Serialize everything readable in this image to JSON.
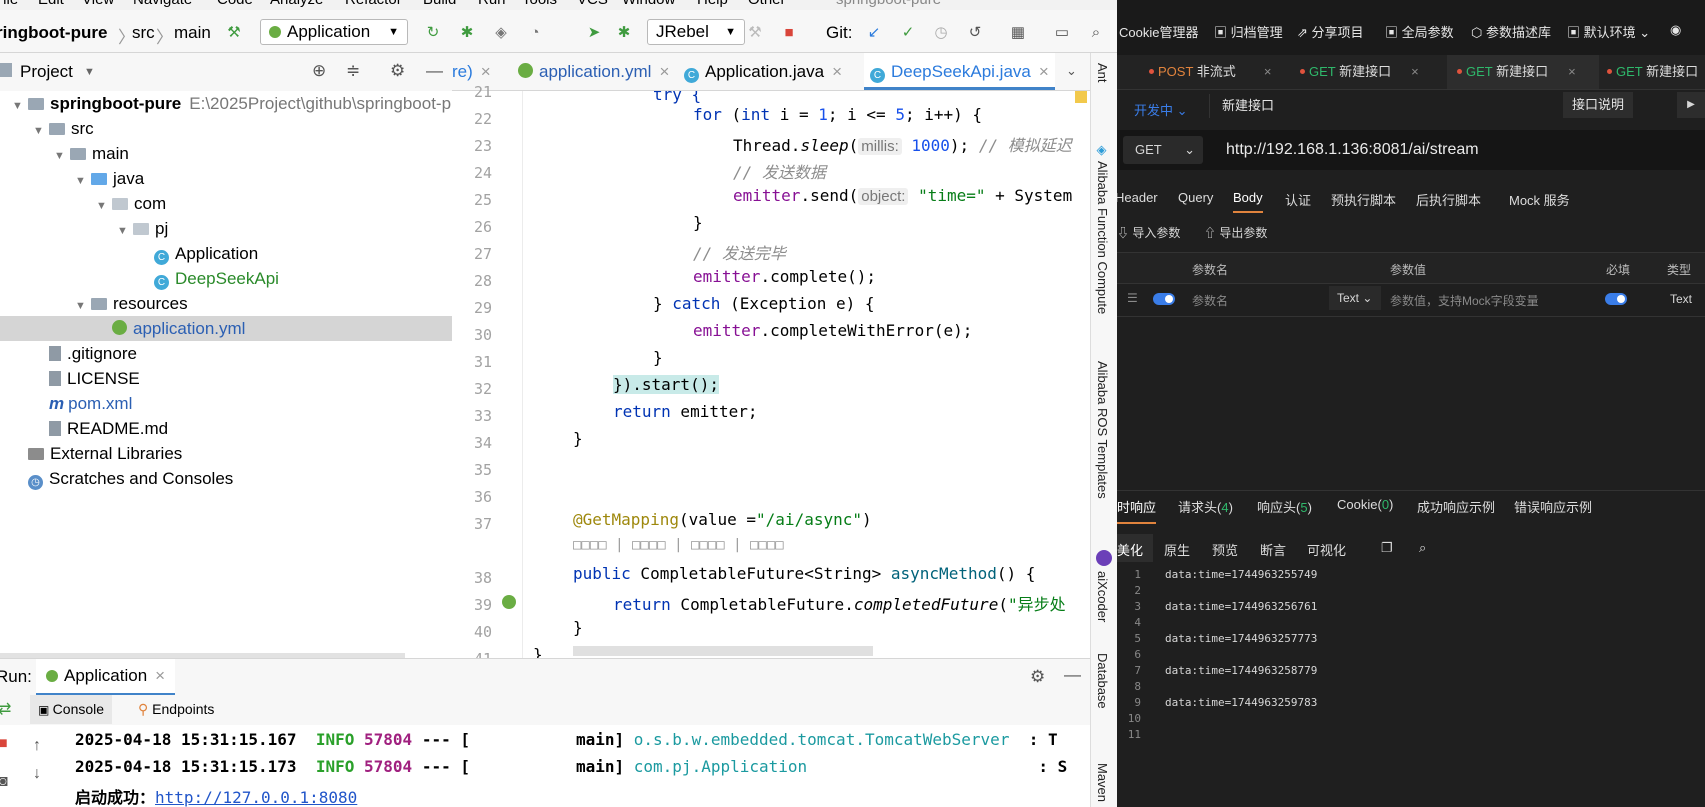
{
  "ide": {
    "menu": [
      "File",
      "Edit",
      "View",
      "Navigate",
      "Code",
      "Analyze",
      "Refactor",
      "Build",
      "Run",
      "Tools",
      "VCS",
      "Window",
      "Help",
      "Other"
    ],
    "window_title": "springboot-pure",
    "breadcrumb": {
      "project": "ringboot-pure",
      "sep": "〉",
      "src": "src",
      "main": "main"
    },
    "run_config": "Application",
    "jrebel": "JRebel",
    "git_label": "Git:",
    "project_panel": {
      "title": "Project"
    },
    "tree": [
      {
        "label": "springboot-pure",
        "path": "E:\\2025Project\\github\\springboot-p",
        "indent": 0,
        "icon": "folder",
        "bold": true
      },
      {
        "label": "src",
        "indent": 1,
        "icon": "folder"
      },
      {
        "label": "main",
        "indent": 2,
        "icon": "folder"
      },
      {
        "label": "java",
        "indent": 3,
        "icon": "folder-blue"
      },
      {
        "label": "com",
        "indent": 4,
        "icon": "package"
      },
      {
        "label": "pj",
        "indent": 5,
        "icon": "package"
      },
      {
        "label": "Application",
        "indent": 6,
        "icon": "class"
      },
      {
        "label": "DeepSeekApi",
        "indent": 6,
        "icon": "class",
        "color": "#2a8a2a"
      },
      {
        "label": "resources",
        "indent": 3,
        "icon": "folder"
      },
      {
        "label": "application.yml",
        "indent": 4,
        "icon": "yml",
        "selected": true,
        "color": "#2b5fb3"
      },
      {
        "label": ".gitignore",
        "indent": 1,
        "icon": "file"
      },
      {
        "label": "LICENSE",
        "indent": 1,
        "icon": "file"
      },
      {
        "label": "pom.xml",
        "indent": 1,
        "icon": "maven",
        "color": "#2b5fb3"
      },
      {
        "label": "README.md",
        "indent": 1,
        "icon": "file"
      },
      {
        "label": "External Libraries",
        "indent": 0,
        "icon": "library"
      },
      {
        "label": "Scratches and Consoles",
        "indent": 0,
        "icon": "scratch"
      }
    ],
    "editor_tabs": [
      {
        "label": "re)"
      },
      {
        "label": "application.yml"
      },
      {
        "label": "Application.java"
      },
      {
        "label": "DeepSeekApi.java",
        "active": true
      }
    ],
    "line_numbers": [
      "21",
      "22",
      "23",
      "24",
      "25",
      "26",
      "27",
      "28",
      "29",
      "30",
      "31",
      "32",
      "33",
      "34",
      "35",
      "36",
      "37",
      "",
      "38",
      "39",
      "40",
      "41"
    ],
    "code_lines": {
      "l21": "try {",
      "l22_kw": "for",
      "l22_a": " (",
      "l22_kw2": "int",
      "l22_b": " i = ",
      "l22_n1": "1",
      "l22_c": "; i <= ",
      "l22_n2": "5",
      "l22_d": "; i++) {",
      "l23_a": "Thread.",
      "l23_fn": "sleep",
      "l23_b": "(",
      "l23_hint": "millis:",
      "l23_n": " 1000",
      "l23_c": ");",
      "l23_cm": " // 模拟延迟",
      "l24_cm": "// 发送数据",
      "l25_a": "emitter",
      "l25_b": ".send(",
      "l25_hint": "object:",
      "l25_st": " \"time=\"",
      "l25_c": " + System",
      "l26": "}",
      "l27_cm": "// 发送完毕",
      "l28_a": "emitter",
      "l28_b": ".complete();",
      "l29_a": "} ",
      "l29_kw": "catch",
      "l29_b": " (Exception e) {",
      "l30_a": "emitter",
      "l30_b": ".completeWithError(e);",
      "l31": "}",
      "l32": "}).start();",
      "l33_kw": "return",
      "l33_b": " emitter;",
      "l34": "}",
      "l37_an": "@GetMapping",
      "l37_a": "(value =",
      "l37_st": "\"/ai/async\"",
      "l37_b": ")",
      "lens": "□□□□ | □□□□ | □□□□ | □□□□",
      "l38_kw": "public",
      "l38_a": " CompletableFuture<String> ",
      "l38_fn": "asyncMethod",
      "l38_b": "() {",
      "l39_kw": "return",
      "l39_a": " CompletableFuture.",
      "l39_fn": "completedFuture",
      "l39_b": "(",
      "l39_st": "\"异步处",
      "l40": "}",
      "l41": "}"
    },
    "right_strip": [
      "Ant",
      "Alibaba Function Compute",
      "Alibaba ROS Templates",
      "aiXcoder",
      "Database",
      "Maven"
    ],
    "run": {
      "label": "Run:",
      "config": "Application",
      "tabs": [
        "Console",
        "Endpoints"
      ]
    },
    "console": [
      {
        "ts": "2025-04-18 15:31:15.167",
        "level": "INFO",
        "pid": "57804",
        "sep": "--- [",
        "thread": "main]",
        "cls": "o.s.b.w.embedded.tomcat.TomcatWebServer",
        "tail": "  : T"
      },
      {
        "ts": "2025-04-18 15:31:15.173",
        "level": "INFO",
        "pid": "57804",
        "sep": "--- [",
        "thread": "main]",
        "cls": "com.pj.Application",
        "tail": "  : S"
      }
    ],
    "console_success": {
      "text": "启动成功：",
      "link": "http://127.0.0.1:8080"
    }
  },
  "api": {
    "top_items": [
      "Cookie管理器",
      "归档管理",
      "分享项目",
      "全局参数",
      "参数描述库",
      "默认环境"
    ],
    "tabs": [
      {
        "method": "POST",
        "label": "非流式"
      },
      {
        "method": "GET",
        "label": "新建接口"
      },
      {
        "method": "GET",
        "label": "新建接口",
        "active": true
      },
      {
        "method": "GET",
        "label": "新建接口"
      }
    ],
    "status": "开发中",
    "name": "新建接口",
    "doc_button": "接口说明",
    "method": "GET",
    "url": "http://192.168.1.136:8081/ai/stream",
    "request_tabs": [
      "Header",
      "Query",
      "Body",
      "认证",
      "预执行脚本",
      "后执行脚本",
      "Mock 服务"
    ],
    "active_request_tab": "Body",
    "import_params": "导入参数",
    "export_params": "导出参数",
    "param_headers": [
      "参数名",
      "参数值",
      "必填",
      "类型"
    ],
    "param_row": {
      "name_placeholder": "参数名",
      "type": "Text",
      "value_placeholder": "参数值，支持Mock字段变量",
      "type2": "Text"
    },
    "response_tabs": [
      {
        "label": "时响应"
      },
      {
        "label": "请求头",
        "count": "4"
      },
      {
        "label": "响应头",
        "count": "5"
      },
      {
        "label": "Cookie",
        "count": "0"
      },
      {
        "label": "成功响应示例"
      },
      {
        "label": "错误响应示例"
      }
    ],
    "response_sub": [
      "美化",
      "原生",
      "预览",
      "断言",
      "可视化"
    ],
    "response_lines": [
      {
        "n": "1",
        "t": "data:time=1744963255749"
      },
      {
        "n": "2",
        "t": ""
      },
      {
        "n": "3",
        "t": "data:time=1744963256761"
      },
      {
        "n": "4",
        "t": ""
      },
      {
        "n": "5",
        "t": "data:time=1744963257773"
      },
      {
        "n": "6",
        "t": ""
      },
      {
        "n": "7",
        "t": "data:time=1744963258779"
      },
      {
        "n": "8",
        "t": ""
      },
      {
        "n": "9",
        "t": "data:time=1744963259783"
      },
      {
        "n": "10",
        "t": ""
      },
      {
        "n": "11",
        "t": ""
      }
    ]
  }
}
